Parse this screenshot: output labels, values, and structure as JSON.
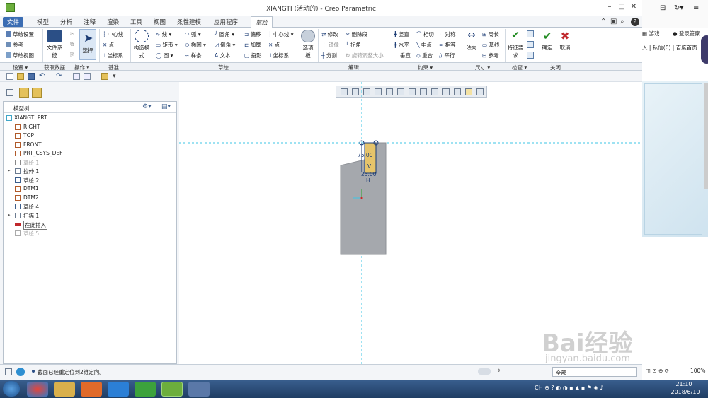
{
  "window": {
    "title": "XIANGTI (活动的) - Creo Parametric"
  },
  "tabs": [
    "文件",
    "模型",
    "分析",
    "注释",
    "渲染",
    "工具",
    "视图",
    "柔性建模",
    "应用程序",
    "草绘"
  ],
  "ribbon": {
    "setup": [
      "草绘设置",
      "参考",
      "草绘视图"
    ],
    "get_data": "文件系统",
    "operations_select": "选择",
    "datum": [
      "中心线",
      "点",
      "坐标系"
    ],
    "construction": "构造模式",
    "sketch_col1": [
      "线",
      "矩形",
      "圆"
    ],
    "sketch_col2": [
      "弧",
      "椭圆",
      "样条"
    ],
    "sketch_col3": [
      "圆角",
      "倒角",
      "文本"
    ],
    "sketch_col4": [
      "偏移",
      "加厚",
      "投影"
    ],
    "sketch_col5": [
      "中心线",
      "点",
      "坐标系"
    ],
    "palette": "选项板",
    "edit_col1": [
      "修改",
      "镜像",
      "分割"
    ],
    "edit_col2": [
      "删除段",
      "拐角",
      "旋转调整大小"
    ],
    "constraint_col1": [
      "竖直",
      "水平",
      "垂直"
    ],
    "constraint_col2": [
      "相切",
      "中点",
      "重合"
    ],
    "constraint_col3": [
      "对称",
      "相等",
      "平行"
    ],
    "dimension_normal": "法向",
    "dimension_col": [
      "周长",
      "基线",
      "参考"
    ],
    "inspect": "特征要求",
    "ok": "确定",
    "cancel": "取消"
  },
  "groups": [
    "设置",
    "获取数据",
    "操作",
    "基准",
    "草绘",
    "编辑",
    "约束",
    "尺寸",
    "检查",
    "关闭"
  ],
  "model_tree": {
    "header": "模型树",
    "items": [
      {
        "label": "XIANGTI.PRT",
        "state": "normal"
      },
      {
        "label": "RIGHT",
        "state": "normal"
      },
      {
        "label": "TOP",
        "state": "normal"
      },
      {
        "label": "FRONT",
        "state": "normal"
      },
      {
        "label": "PRT_CSYS_DEF",
        "state": "normal"
      },
      {
        "label": "草绘 1",
        "state": "dim"
      },
      {
        "label": "拉伸 1",
        "state": "normal"
      },
      {
        "label": "草绘 2",
        "state": "normal"
      },
      {
        "label": "DTM1",
        "state": "normal"
      },
      {
        "label": "DTM2",
        "state": "normal"
      },
      {
        "label": "草绘 4",
        "state": "normal"
      },
      {
        "label": "扫描 1",
        "state": "normal"
      },
      {
        "label": "在此插入",
        "state": "insert"
      },
      {
        "label": "草绘 5",
        "state": "dim"
      }
    ]
  },
  "sketch": {
    "dim_value_1": "75.00",
    "dim_value_2": "25.00",
    "constraint_v": "V",
    "constraint_h": "H"
  },
  "status": {
    "message": "截面已经重定位到2维定向。",
    "filter": "全部"
  },
  "browser": {
    "game": "游戏",
    "login": "登录管家",
    "links": "入 | 私信(0) | 百度首页",
    "zoom": "100%"
  },
  "clock": {
    "time": "21:10",
    "date": "2018/6/10"
  },
  "watermark": {
    "brand": "Bai经验",
    "url": "jingyan.baidu.com"
  },
  "colors": {
    "accent": "#3b6db3",
    "ok": "#1f8a1f",
    "cancel": "#c0282c",
    "sketch_fill": "#e6c46a",
    "part_gray": "#a5a8ad",
    "dashed": "#3cc6e6"
  }
}
